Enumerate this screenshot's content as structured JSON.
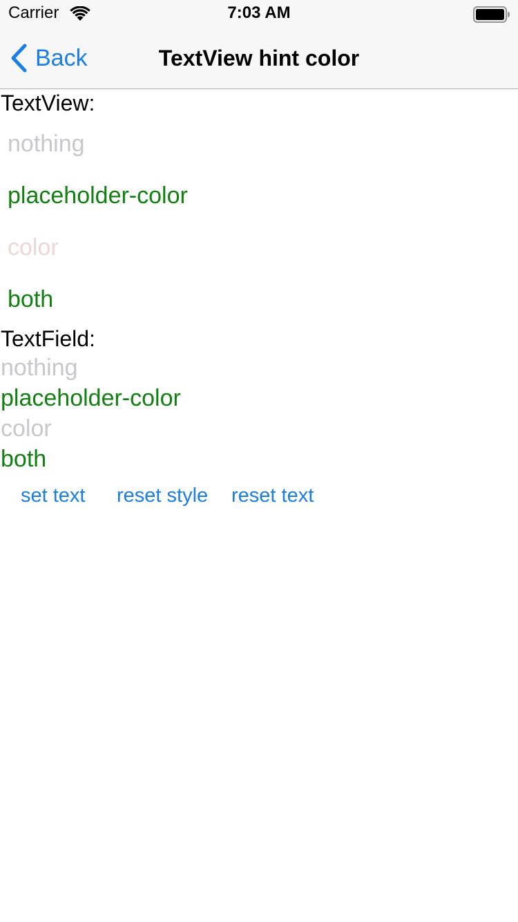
{
  "status_bar": {
    "carrier": "Carrier",
    "time": "7:03 AM",
    "wifi_icon": "wifi-icon",
    "battery_icon": "battery-icon"
  },
  "nav_bar": {
    "back_label": "Back",
    "back_icon": "chevron-left-icon",
    "title": "TextView hint color"
  },
  "textview_section": {
    "label": "TextView:",
    "items": [
      {
        "text": "nothing",
        "color": "#c7c7cd"
      },
      {
        "text": "placeholder-color",
        "color": "#118011"
      },
      {
        "text": "color",
        "color": "#eed6d6"
      },
      {
        "text": "both",
        "color": "#118011"
      }
    ]
  },
  "textfield_section": {
    "label": "TextField:",
    "items": [
      {
        "text": "nothing",
        "color": "#c7c7cd"
      },
      {
        "text": "placeholder-color",
        "color": "#118011"
      },
      {
        "text": "color",
        "color": "#c7c7cd"
      },
      {
        "text": "both",
        "color": "#118011"
      }
    ]
  },
  "actions": {
    "set_text": "set text",
    "reset_style": "reset style",
    "reset_text": "reset text"
  },
  "colors": {
    "accent": "#1b7ee8",
    "placeholder_default": "#c7c7cd",
    "green": "#118011",
    "pink": "#eed6d6"
  }
}
